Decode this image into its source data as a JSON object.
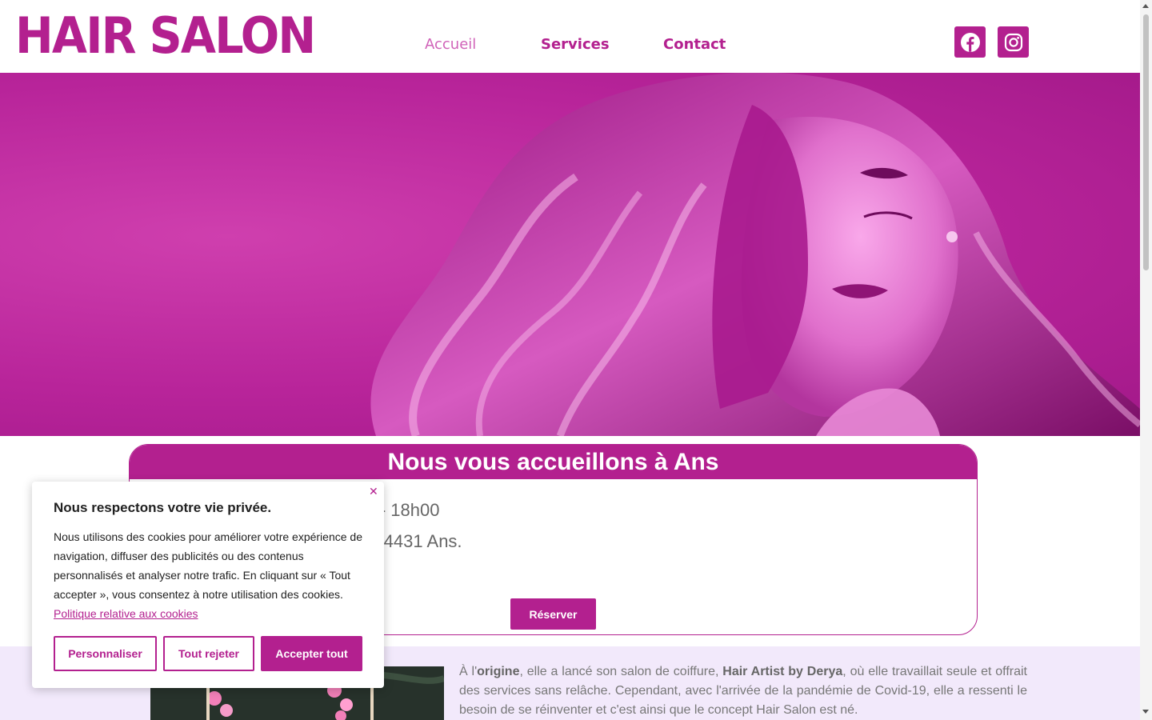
{
  "header": {
    "logo": "HAIR SALON",
    "nav": [
      "Accueil",
      "Services",
      "Contact"
    ],
    "social": [
      "facebook-icon",
      "instagram-icon"
    ]
  },
  "card": {
    "title": "Nous vous accueillons à Ans",
    "line1": "h00 - 18h00",
    "line2": "t 3c, 4431 Ans.",
    "button": "Réserver"
  },
  "about": {
    "t1": "À l'",
    "t2": "origine",
    "t3": ", elle a lancé son salon de coiffure, ",
    "t4": "Hair Artist by Derya",
    "t5": ", où elle travaillait seule et offrait des services sans relâche. Cependant, avec l'arrivée de la pandémie de Covid-19, elle a ressenti le besoin de se réinventer et c'est ainsi que le concept Hair Salon est né."
  },
  "cookie": {
    "title": "Nous respectons votre vie privée.",
    "body": "Nous utilisons des cookies pour améliorer votre expérience de navigation, diffuser des publicités ou des contenus personnalisés et analyser notre trafic. En cliquant sur « Tout accepter », vous consentez à notre utilisation des cookies.",
    "link": "Politique relative aux cookies",
    "customize": "Personnaliser",
    "reject": "Tout rejeter",
    "accept": "Accepter tout"
  },
  "colors": {
    "brand": "#b3208f",
    "about_bg": "#f2e9fb"
  }
}
